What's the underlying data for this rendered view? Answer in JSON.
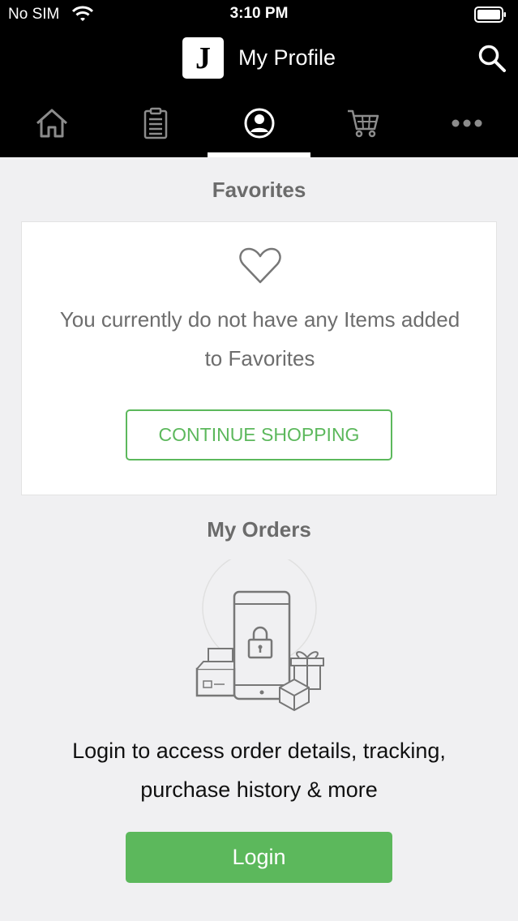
{
  "status_bar": {
    "carrier": "No SIM",
    "time": "3:10 PM"
  },
  "header": {
    "logo_letter": "J",
    "title": "My Profile"
  },
  "tabs": [
    {
      "name": "home",
      "icon": "home-icon",
      "active": false
    },
    {
      "name": "orders",
      "icon": "clipboard-icon",
      "active": false
    },
    {
      "name": "profile",
      "icon": "profile-icon",
      "active": true
    },
    {
      "name": "cart",
      "icon": "cart-icon",
      "active": false
    },
    {
      "name": "more",
      "icon": "more-icon",
      "active": false
    }
  ],
  "favorites": {
    "title": "Favorites",
    "icon": "heart-icon",
    "empty_message": "You currently do not have any Items added to Favorites",
    "continue_label": "CONTINUE SHOPPING"
  },
  "orders": {
    "title": "My Orders",
    "illustration": "locked-phone-illustration",
    "message": "Login to access order details, tracking, purchase history & more",
    "login_label": "Login"
  },
  "colors": {
    "accent": "#5cb85c",
    "header_bg": "#000000",
    "page_bg": "#f0f0f2"
  }
}
